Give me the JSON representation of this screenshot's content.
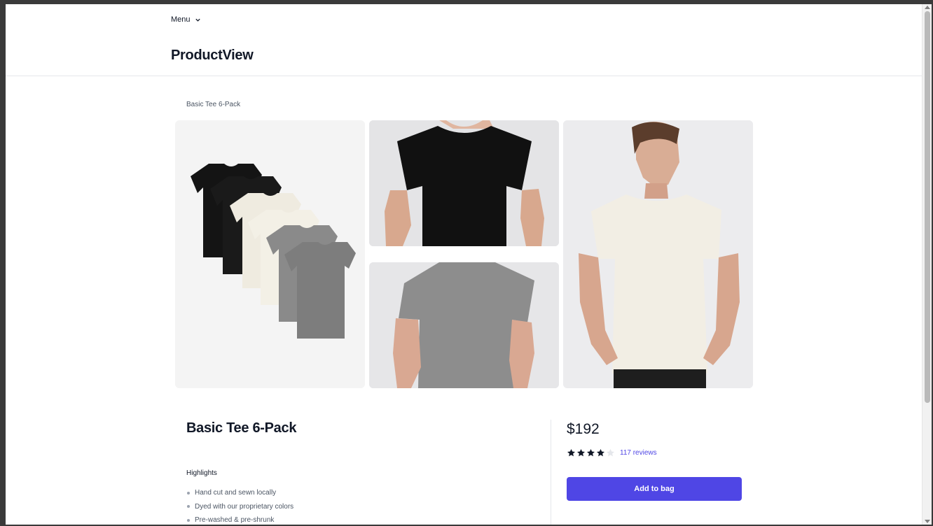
{
  "header": {
    "menu_label": "Menu",
    "app_title": "ProductView"
  },
  "breadcrumb": "Basic Tee 6-Pack",
  "gallery": [
    {
      "alt": "Two each of gray, white, and black shirts laying flat."
    },
    {
      "alt": "Model wearing plain black basic tee."
    },
    {
      "alt": "Model wearing plain gray basic tee."
    },
    {
      "alt": "Model wearing plain white basic tee."
    }
  ],
  "product": {
    "name": "Basic Tee 6-Pack",
    "price": "$192",
    "rating": 4,
    "rating_max": 5,
    "reviews_label": "117 reviews",
    "add_button": "Add to bag"
  },
  "highlights": {
    "title": "Highlights",
    "items": [
      "Hand cut and sewn locally",
      "Dyed with our proprietary colors",
      "Pre-washed & pre-shrunk"
    ]
  },
  "colors": {
    "accent": "#4f46e5",
    "star_filled": "#111827",
    "star_empty": "#e5e7eb"
  }
}
